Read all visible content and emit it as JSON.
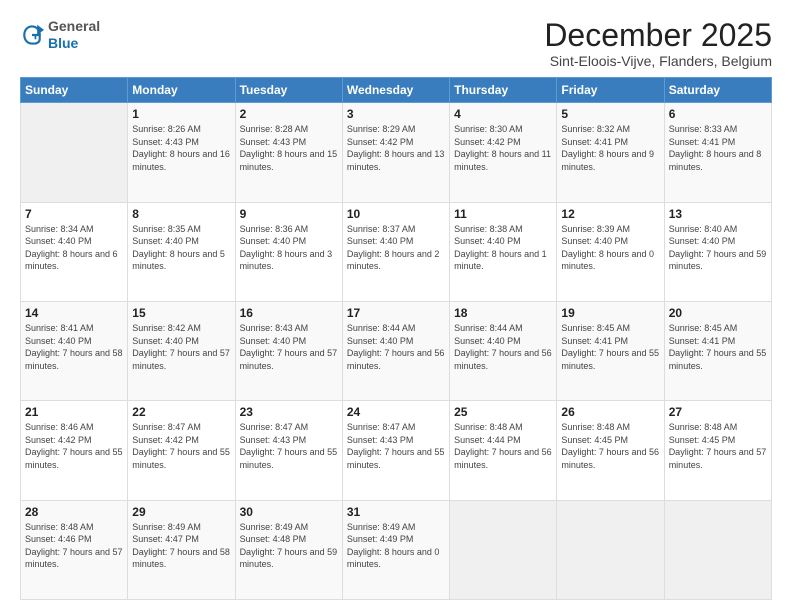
{
  "header": {
    "logo_general": "General",
    "logo_blue": "Blue",
    "month_title": "December 2025",
    "location": "Sint-Eloois-Vijve, Flanders, Belgium"
  },
  "days_of_week": [
    "Sunday",
    "Monday",
    "Tuesday",
    "Wednesday",
    "Thursday",
    "Friday",
    "Saturday"
  ],
  "weeks": [
    [
      {
        "day": "",
        "sunrise": "",
        "sunset": "",
        "daylight": ""
      },
      {
        "day": "1",
        "sunrise": "Sunrise: 8:26 AM",
        "sunset": "Sunset: 4:43 PM",
        "daylight": "Daylight: 8 hours and 16 minutes."
      },
      {
        "day": "2",
        "sunrise": "Sunrise: 8:28 AM",
        "sunset": "Sunset: 4:43 PM",
        "daylight": "Daylight: 8 hours and 15 minutes."
      },
      {
        "day": "3",
        "sunrise": "Sunrise: 8:29 AM",
        "sunset": "Sunset: 4:42 PM",
        "daylight": "Daylight: 8 hours and 13 minutes."
      },
      {
        "day": "4",
        "sunrise": "Sunrise: 8:30 AM",
        "sunset": "Sunset: 4:42 PM",
        "daylight": "Daylight: 8 hours and 11 minutes."
      },
      {
        "day": "5",
        "sunrise": "Sunrise: 8:32 AM",
        "sunset": "Sunset: 4:41 PM",
        "daylight": "Daylight: 8 hours and 9 minutes."
      },
      {
        "day": "6",
        "sunrise": "Sunrise: 8:33 AM",
        "sunset": "Sunset: 4:41 PM",
        "daylight": "Daylight: 8 hours and 8 minutes."
      }
    ],
    [
      {
        "day": "7",
        "sunrise": "Sunrise: 8:34 AM",
        "sunset": "Sunset: 4:40 PM",
        "daylight": "Daylight: 8 hours and 6 minutes."
      },
      {
        "day": "8",
        "sunrise": "Sunrise: 8:35 AM",
        "sunset": "Sunset: 4:40 PM",
        "daylight": "Daylight: 8 hours and 5 minutes."
      },
      {
        "day": "9",
        "sunrise": "Sunrise: 8:36 AM",
        "sunset": "Sunset: 4:40 PM",
        "daylight": "Daylight: 8 hours and 3 minutes."
      },
      {
        "day": "10",
        "sunrise": "Sunrise: 8:37 AM",
        "sunset": "Sunset: 4:40 PM",
        "daylight": "Daylight: 8 hours and 2 minutes."
      },
      {
        "day": "11",
        "sunrise": "Sunrise: 8:38 AM",
        "sunset": "Sunset: 4:40 PM",
        "daylight": "Daylight: 8 hours and 1 minute."
      },
      {
        "day": "12",
        "sunrise": "Sunrise: 8:39 AM",
        "sunset": "Sunset: 4:40 PM",
        "daylight": "Daylight: 8 hours and 0 minutes."
      },
      {
        "day": "13",
        "sunrise": "Sunrise: 8:40 AM",
        "sunset": "Sunset: 4:40 PM",
        "daylight": "Daylight: 7 hours and 59 minutes."
      }
    ],
    [
      {
        "day": "14",
        "sunrise": "Sunrise: 8:41 AM",
        "sunset": "Sunset: 4:40 PM",
        "daylight": "Daylight: 7 hours and 58 minutes."
      },
      {
        "day": "15",
        "sunrise": "Sunrise: 8:42 AM",
        "sunset": "Sunset: 4:40 PM",
        "daylight": "Daylight: 7 hours and 57 minutes."
      },
      {
        "day": "16",
        "sunrise": "Sunrise: 8:43 AM",
        "sunset": "Sunset: 4:40 PM",
        "daylight": "Daylight: 7 hours and 57 minutes."
      },
      {
        "day": "17",
        "sunrise": "Sunrise: 8:44 AM",
        "sunset": "Sunset: 4:40 PM",
        "daylight": "Daylight: 7 hours and 56 minutes."
      },
      {
        "day": "18",
        "sunrise": "Sunrise: 8:44 AM",
        "sunset": "Sunset: 4:40 PM",
        "daylight": "Daylight: 7 hours and 56 minutes."
      },
      {
        "day": "19",
        "sunrise": "Sunrise: 8:45 AM",
        "sunset": "Sunset: 4:41 PM",
        "daylight": "Daylight: 7 hours and 55 minutes."
      },
      {
        "day": "20",
        "sunrise": "Sunrise: 8:45 AM",
        "sunset": "Sunset: 4:41 PM",
        "daylight": "Daylight: 7 hours and 55 minutes."
      }
    ],
    [
      {
        "day": "21",
        "sunrise": "Sunrise: 8:46 AM",
        "sunset": "Sunset: 4:42 PM",
        "daylight": "Daylight: 7 hours and 55 minutes."
      },
      {
        "day": "22",
        "sunrise": "Sunrise: 8:47 AM",
        "sunset": "Sunset: 4:42 PM",
        "daylight": "Daylight: 7 hours and 55 minutes."
      },
      {
        "day": "23",
        "sunrise": "Sunrise: 8:47 AM",
        "sunset": "Sunset: 4:43 PM",
        "daylight": "Daylight: 7 hours and 55 minutes."
      },
      {
        "day": "24",
        "sunrise": "Sunrise: 8:47 AM",
        "sunset": "Sunset: 4:43 PM",
        "daylight": "Daylight: 7 hours and 55 minutes."
      },
      {
        "day": "25",
        "sunrise": "Sunrise: 8:48 AM",
        "sunset": "Sunset: 4:44 PM",
        "daylight": "Daylight: 7 hours and 56 minutes."
      },
      {
        "day": "26",
        "sunrise": "Sunrise: 8:48 AM",
        "sunset": "Sunset: 4:45 PM",
        "daylight": "Daylight: 7 hours and 56 minutes."
      },
      {
        "day": "27",
        "sunrise": "Sunrise: 8:48 AM",
        "sunset": "Sunset: 4:45 PM",
        "daylight": "Daylight: 7 hours and 57 minutes."
      }
    ],
    [
      {
        "day": "28",
        "sunrise": "Sunrise: 8:48 AM",
        "sunset": "Sunset: 4:46 PM",
        "daylight": "Daylight: 7 hours and 57 minutes."
      },
      {
        "day": "29",
        "sunrise": "Sunrise: 8:49 AM",
        "sunset": "Sunset: 4:47 PM",
        "daylight": "Daylight: 7 hours and 58 minutes."
      },
      {
        "day": "30",
        "sunrise": "Sunrise: 8:49 AM",
        "sunset": "Sunset: 4:48 PM",
        "daylight": "Daylight: 7 hours and 59 minutes."
      },
      {
        "day": "31",
        "sunrise": "Sunrise: 8:49 AM",
        "sunset": "Sunset: 4:49 PM",
        "daylight": "Daylight: 8 hours and 0 minutes."
      },
      {
        "day": "",
        "sunrise": "",
        "sunset": "",
        "daylight": ""
      },
      {
        "day": "",
        "sunrise": "",
        "sunset": "",
        "daylight": ""
      },
      {
        "day": "",
        "sunrise": "",
        "sunset": "",
        "daylight": ""
      }
    ]
  ]
}
